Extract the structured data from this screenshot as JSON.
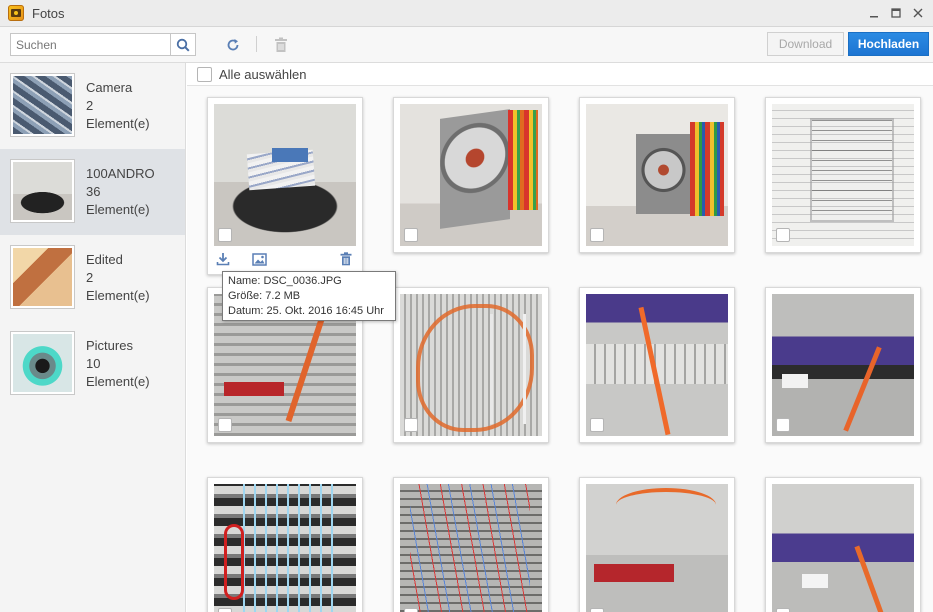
{
  "window": {
    "title": "Fotos",
    "controls": {
      "minimize": "‗",
      "maximize": "□",
      "close": "✕"
    }
  },
  "toolbar": {
    "search_placeholder": "Suchen",
    "download_label": "Download",
    "upload_label": "Hochladen"
  },
  "sidebar": {
    "albums": [
      {
        "name": "Camera",
        "count": "2",
        "unit": "Element(e)",
        "selected": false
      },
      {
        "name": "100ANDRO",
        "count": "36",
        "unit": "Element(e)",
        "selected": true
      },
      {
        "name": "Edited",
        "count": "2",
        "unit": "Element(e)",
        "selected": false
      },
      {
        "name": "Pictures",
        "count": "10",
        "unit": "Element(e)",
        "selected": false
      }
    ]
  },
  "content": {
    "select_all_label": "Alle auswählen",
    "tooltip": {
      "name": "Name: DSC_0036.JPG",
      "size": "Größe: 7.2 MB",
      "date": "Datum: 25. Okt. 2016 16:45 Uhr"
    }
  },
  "colors": {
    "accent": "#1d75d2",
    "selected_album_bg": "#dfe2e6"
  },
  "icons": {
    "app": "photos-app-icon",
    "search": "magnifier-icon",
    "refresh": "refresh-icon",
    "delete": "trash-icon",
    "download": "download-icon",
    "open": "image-icon"
  }
}
